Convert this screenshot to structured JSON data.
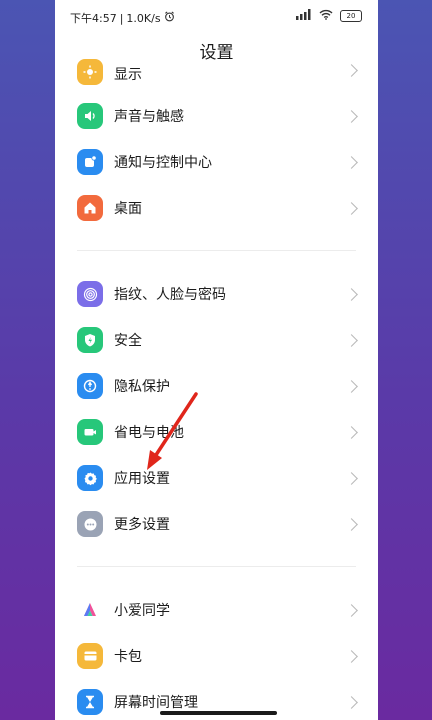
{
  "status": {
    "time": "下午4:57",
    "speed": "1.0K/s",
    "battery": "20"
  },
  "header": {
    "title": "设置"
  },
  "groups": [
    {
      "items": [
        {
          "label": "显示",
          "icon": "display-icon",
          "color": "#f5b83a"
        },
        {
          "label": "声音与触感",
          "icon": "speaker-icon",
          "color": "#27c77a"
        },
        {
          "label": "通知与控制中心",
          "icon": "notification-icon",
          "color": "#2a8cf0"
        },
        {
          "label": "桌面",
          "icon": "home-icon",
          "color": "#f26a3d"
        }
      ]
    },
    {
      "items": [
        {
          "label": "指纹、人脸与密码",
          "icon": "fingerprint-icon",
          "color": "#7b6ee8"
        },
        {
          "label": "安全",
          "icon": "shield-icon",
          "color": "#27c77a"
        },
        {
          "label": "隐私保护",
          "icon": "privacy-icon",
          "color": "#2a8cf0"
        },
        {
          "label": "省电与电池",
          "icon": "battery-icon",
          "color": "#27c77a"
        },
        {
          "label": "应用设置",
          "icon": "gear-icon",
          "color": "#2a8cf0"
        },
        {
          "label": "更多设置",
          "icon": "more-icon",
          "color": "#9aa3b5"
        }
      ]
    },
    {
      "items": [
        {
          "label": "小爱同学",
          "icon": "xiaoai-icon",
          "color": "#ffffff"
        },
        {
          "label": "卡包",
          "icon": "wallet-icon",
          "color": "#f5b83a"
        },
        {
          "label": "屏幕时间管理",
          "icon": "hourglass-icon",
          "color": "#2a8cf0"
        }
      ]
    }
  ]
}
